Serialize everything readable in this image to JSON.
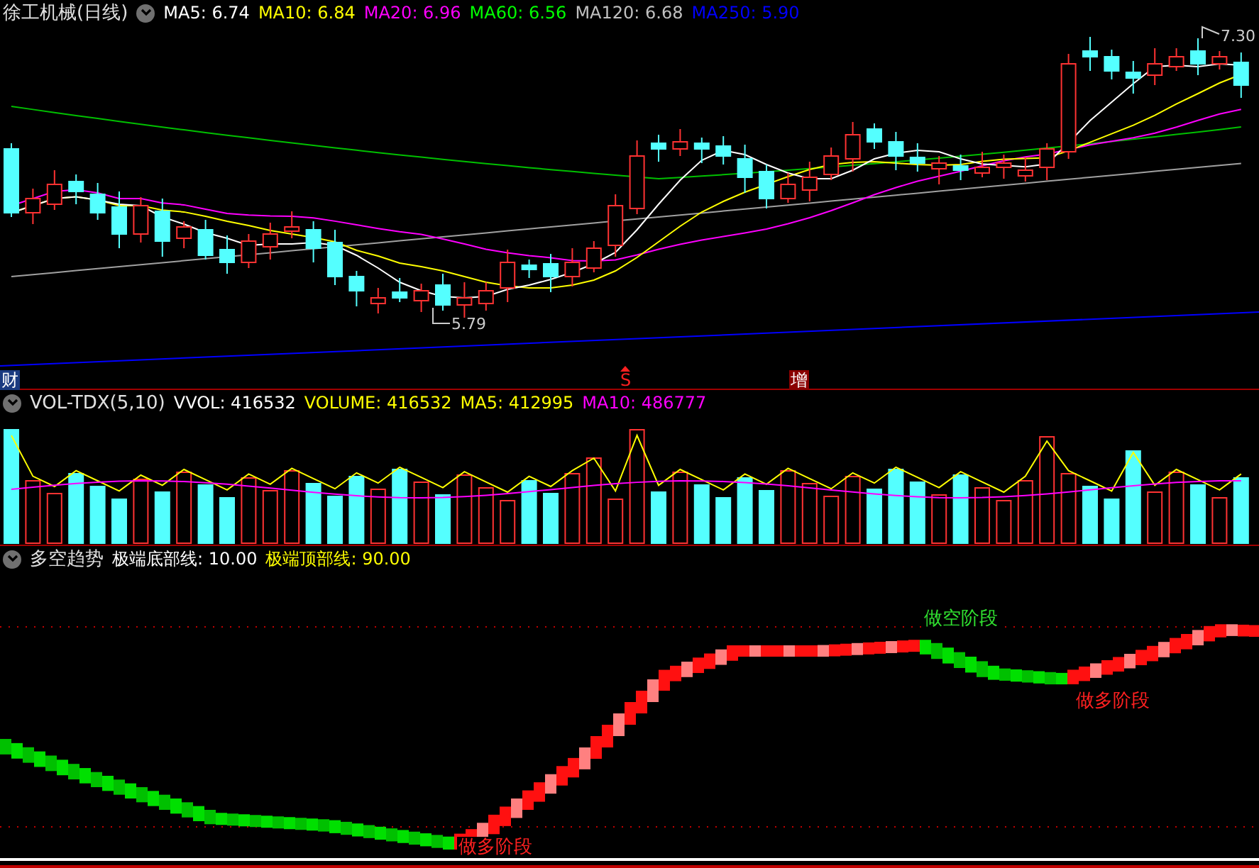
{
  "stock_panel": {
    "title": "徐工机械(日线)",
    "indicators": [
      {
        "label": "MA5: 6.74",
        "color": "#ffffff"
      },
      {
        "label": "MA10: 6.84",
        "color": "#ffff00"
      },
      {
        "label": "MA20: 6.96",
        "color": "#ff00ff"
      },
      {
        "label": "MA60: 6.56",
        "color": "#00ff00"
      },
      {
        "label": "MA120: 6.68",
        "color": "#c0c0c0"
      },
      {
        "label": "MA250: 5.90",
        "color": "#0000ff"
      }
    ],
    "high_label": "7.30",
    "low_label": "5.79",
    "markers": [
      {
        "text": "财",
        "kind": "finance"
      },
      {
        "text": "S",
        "kind": "signal"
      },
      {
        "text": "增",
        "kind": "increase"
      }
    ]
  },
  "volume_panel": {
    "title": "VOL-TDX(5,10)",
    "indicators": [
      {
        "label": "VVOL: 416532",
        "color": "#ffffff"
      },
      {
        "label": "VOLUME: 416532",
        "color": "#ffff00"
      },
      {
        "label": "MA5: 412995",
        "color": "#ffff00"
      },
      {
        "label": "MA10: 486777",
        "color": "#ff00ff"
      }
    ]
  },
  "trend_panel": {
    "title": "多空趋势",
    "indicators": [
      {
        "label": "极端底部线: 10.00",
        "color": "#ffffff"
      },
      {
        "label": "极端顶部线: 90.00",
        "color": "#ffff00"
      }
    ],
    "labels": [
      {
        "text": "做多阶段",
        "kind": "long"
      },
      {
        "text": "做空阶段",
        "kind": "short"
      },
      {
        "text": "做多阶段",
        "kind": "long"
      }
    ]
  }
}
